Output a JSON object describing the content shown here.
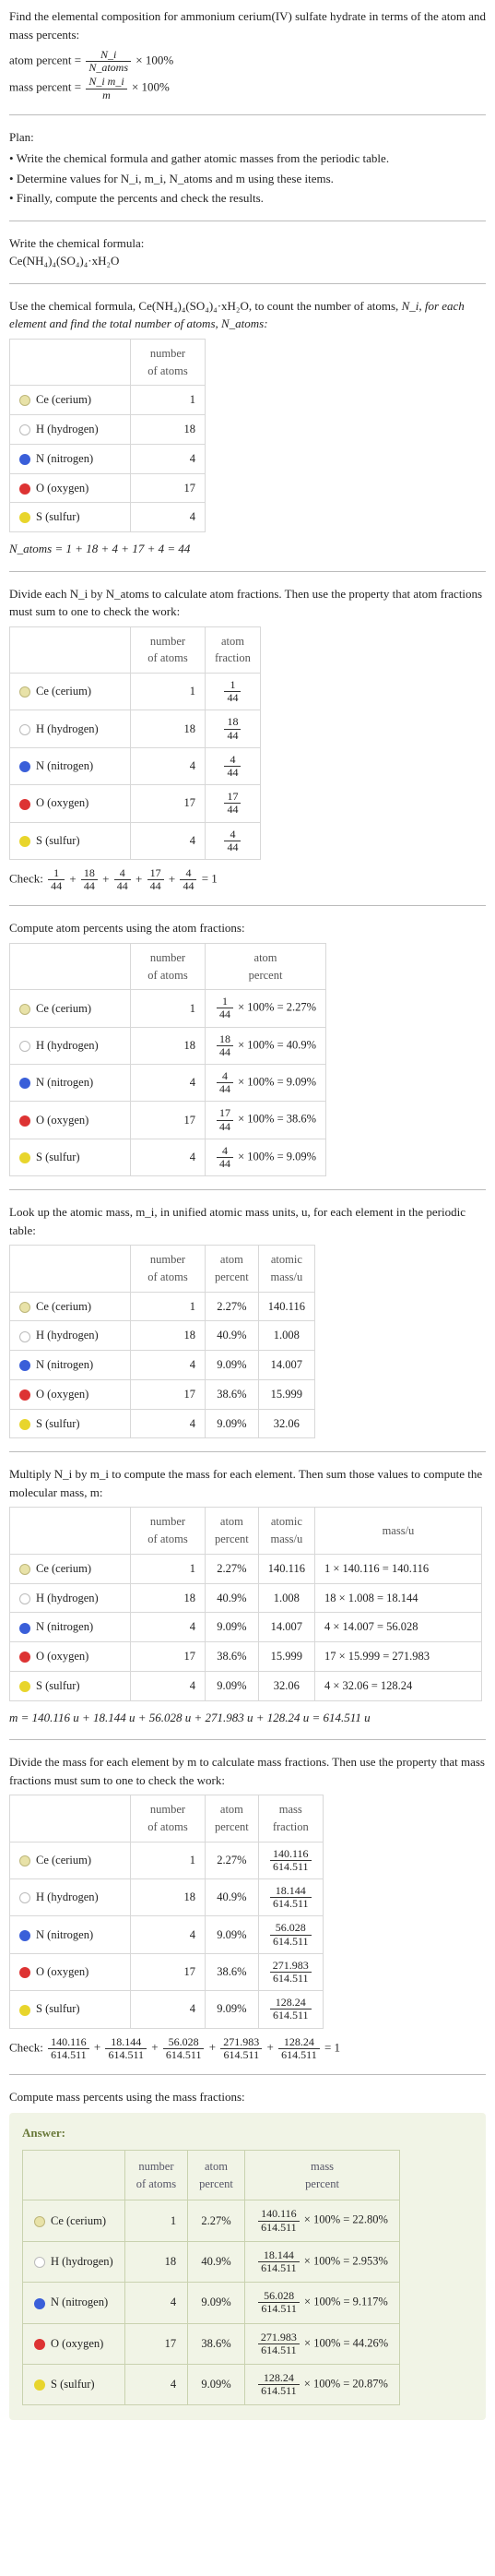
{
  "intro": "Find the elemental composition for ammonium cerium(IV) sulfate hydrate in terms of the atom and mass percents:",
  "atom_percent_lhs": "atom percent =",
  "atom_percent_num": "N_i",
  "atom_percent_den": "N_atoms",
  "mass_percent_lhs": "mass percent =",
  "mass_percent_num": "N_i m_i",
  "mass_percent_den": "m",
  "times100": "× 100%",
  "plan_label": "Plan:",
  "plan_items": [
    "Write the chemical formula and gather atomic masses from the periodic table.",
    "Determine values for N_i, m_i, N_atoms and m using these items.",
    "Finally, compute the percents and check the results."
  ],
  "write_formula_label": "Write the chemical formula:",
  "chem_formula_html": "Ce(NH₄)₄(SO₄)₄·xH₂O",
  "count_atoms_intro_a": "Use the chemical formula, Ce(NH₄)₄(SO₄)₄·xH₂O, to count the number of atoms, ",
  "count_atoms_intro_b": "N_i, for each element and find the total number of atoms, N_atoms:",
  "headers": {
    "num_atoms": "number\nof atoms",
    "atom_frac": "atom\nfraction",
    "atom_pct": "atom\npercent",
    "atomic_mass": "atomic\nmass/u",
    "mass_u": "mass/u",
    "mass_frac": "mass\nfraction",
    "mass_pct": "mass\npercent"
  },
  "elements": [
    {
      "key": "ce",
      "name": "Ce (cerium)",
      "n": 1,
      "frac_num": "1",
      "pct": "2.27%",
      "pct_expr": "1/44 × 100% = 2.27%",
      "amu": "140.116",
      "mass_expr": "1 × 140.116 = 140.116",
      "mfrac_num": "140.116",
      "mpct_expr": "140.116/614.511 × 100% = 22.80%"
    },
    {
      "key": "h",
      "name": "H (hydrogen)",
      "n": 18,
      "frac_num": "18",
      "pct": "40.9%",
      "pct_expr": "18/44 × 100% = 40.9%",
      "amu": "1.008",
      "mass_expr": "18 × 1.008 = 18.144",
      "mfrac_num": "18.144",
      "mpct_expr": "18.144/614.511 × 100% = 2.953%"
    },
    {
      "key": "n",
      "name": "N (nitrogen)",
      "n": 4,
      "frac_num": "4",
      "pct": "9.09%",
      "pct_expr": "4/44 × 100% = 9.09%",
      "amu": "14.007",
      "mass_expr": "4 × 14.007 = 56.028",
      "mfrac_num": "56.028",
      "mpct_expr": "56.028/614.511 × 100% = 9.117%"
    },
    {
      "key": "o",
      "name": "O (oxygen)",
      "n": 17,
      "frac_num": "17",
      "pct": "38.6%",
      "pct_expr": "17/44 × 100% = 38.6%",
      "amu": "15.999",
      "mass_expr": "17 × 15.999 = 271.983",
      "mfrac_num": "271.983",
      "mpct_expr": "271.983/614.511 × 100% = 44.26%"
    },
    {
      "key": "s",
      "name": "S (sulfur)",
      "n": 4,
      "frac_num": "4",
      "pct": "9.09%",
      "pct_expr": "4/44 × 100% = 9.09%",
      "amu": "32.06",
      "mass_expr": "4 × 32.06 = 128.24",
      "mfrac_num": "128.24",
      "mpct_expr": "128.24/614.511 × 100% = 20.87%"
    }
  ],
  "total_atoms_line": "N_atoms = 1 + 18 + 4 + 17 + 4 = 44",
  "divide_intro": "Divide each N_i by N_atoms to calculate atom fractions. Then use the property that atom fractions must sum to one to check the work:",
  "frac_den": "44",
  "check_frac_line": "Check: 1/44 + 18/44 + 4/44 + 17/44 + 4/44 = 1",
  "compute_atom_pct_intro": "Compute atom percents using the atom fractions:",
  "lookup_mass_intro": "Look up the atomic mass, m_i, in unified atomic mass units, u, for each element in the periodic table:",
  "multiply_intro": "Multiply N_i by m_i to compute the mass for each element. Then sum those values to compute the molecular mass, m:",
  "total_mass_line": "m = 140.116 u + 18.144 u + 56.028 u + 271.983 u + 128.24 u = 614.511 u",
  "divide_mass_intro": "Divide the mass for each element by m to calculate mass fractions. Then use the property that mass fractions must sum to one to check the work:",
  "mfrac_den": "614.511",
  "check_mass_line": "Check: 140.116/614.511 + 18.144/614.511 + 56.028/614.511 + 271.983/614.511 + 128.24/614.511 = 1",
  "compute_mass_pct_intro": "Compute mass percents using the mass fractions:",
  "answer_label": "Answer:"
}
